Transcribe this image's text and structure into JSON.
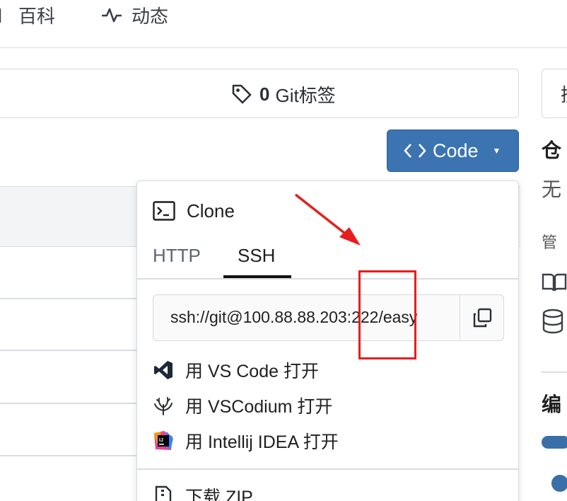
{
  "nav": {
    "wiki_label": "百科",
    "activity_label": "动态"
  },
  "tags": {
    "count": "0",
    "label": "Git标签"
  },
  "right_column": {
    "search_fragment": "搜",
    "heading_fragment": "仓",
    "desc_fragment": "无",
    "manage_fragment": "管",
    "lang_heading_fragment": "编"
  },
  "code_button": {
    "label": "Code"
  },
  "clone_panel": {
    "title": "Clone",
    "tabs": [
      "HTTP",
      "SSH"
    ],
    "active_tab": "SSH",
    "url": "ssh://git@100.88.88.203:222/easy",
    "open_items": [
      {
        "label": "用 VS Code 打开",
        "icon": "vscode-icon"
      },
      {
        "label": "用 VSCodium 打开",
        "icon": "vscodium-icon"
      },
      {
        "label": "用 Intellij IDEA 打开",
        "icon": "intellij-icon"
      }
    ],
    "download_label": "下载 ZIP"
  },
  "colors": {
    "accent": "#3c74b1",
    "annotation": "#e61e1e"
  }
}
